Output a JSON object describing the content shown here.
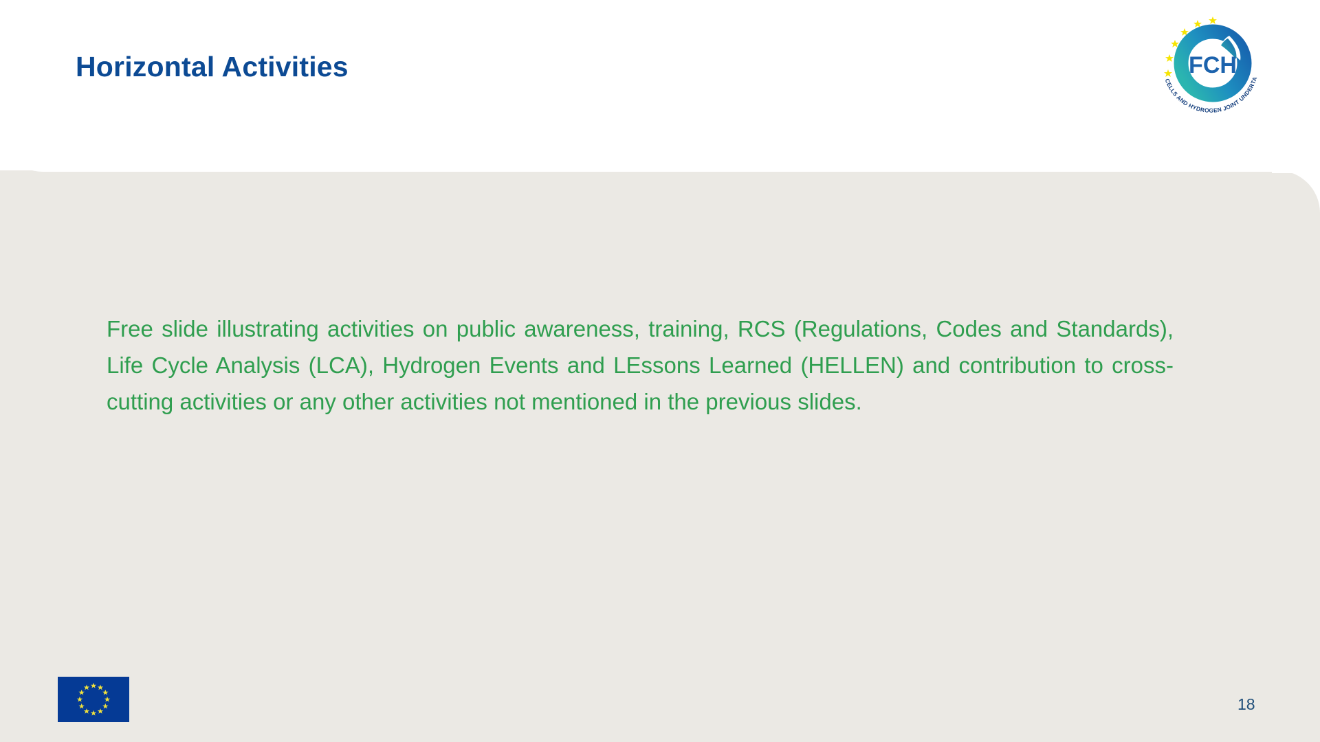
{
  "slide": {
    "title": "Horizontal Activities",
    "body_text": "Free slide illustrating activities on public awareness, training, RCS (Regulations, Codes and Standards), Life Cycle Analysis (LCA), Hydrogen Events and LEssons Learned (HELLEN) and contribution to cross-cutting activities or any other activities not mentioned in the previous slides.",
    "page_number": "18",
    "lines": [
      "Free slide illustrating activities on public awareness, training, RCS (Regulations, Codes",
      "and Standards), Life Cycle Analysis (LCA), Hydrogen Events and LEssons Learned",
      "(HELLEN) and contribution to cross-cutting activities or any other activities not",
      "mentioned in the previous slides."
    ]
  },
  "logo": {
    "name": "fch-ju-logo",
    "acronym": "FCH",
    "tagline": "FUEL CELLS AND HYDROGEN JOINT UNDERTAKING",
    "ring_gradient_start": "#2bb5b0",
    "ring_gradient_end": "#1762ae",
    "star_color": "#f6e400",
    "text_color": "#1c63ad"
  },
  "eu_flag": {
    "name": "eu-flag",
    "background": "#053a95",
    "star_color": "#f2e23c",
    "star_count": 12
  },
  "colors": {
    "title_blue": "#0c4a94",
    "body_green": "#2f9e4f",
    "panel_beige": "#ebe9e4",
    "header_white": "#ffffff",
    "page_number_blue": "#1f4e79"
  }
}
